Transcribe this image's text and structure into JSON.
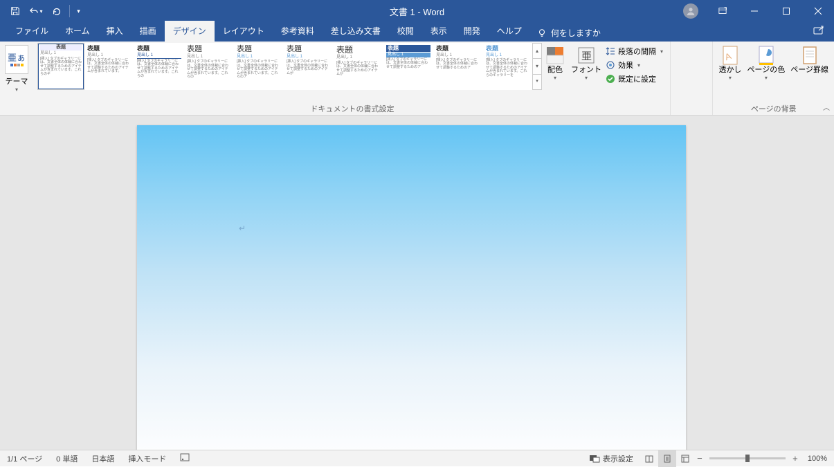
{
  "title": "文書 1  -  Word",
  "tabs": [
    "ファイル",
    "ホーム",
    "挿入",
    "描画",
    "デザイン",
    "レイアウト",
    "参考資料",
    "差し込み文書",
    "校閲",
    "表示",
    "開発",
    "ヘルプ"
  ],
  "active_tab_index": 4,
  "tellme": "何をしますか",
  "ribbon": {
    "themes_label": "テーマ",
    "formatting_group_label": "ドキュメントの書式設定",
    "gallery_more_tip": "▾",
    "styles": [
      {
        "title": "表題",
        "sub": "見出し 1",
        "body": "[挿入] タブのギャラリーには、文書全体の体裁に合わせて調整するためのアイテムが含まれています。これらのギ"
      },
      {
        "title": "表題",
        "sub": "見出し 1",
        "body": "[挿入] タブのギャラリーには、文書全体の体裁に合わせて調整するためのアイテムが含まれています。"
      },
      {
        "title": "表題",
        "sub": "見出し 1",
        "body": "[挿入] タブのギャラリーには、文書全体の体裁に合わせて調整するためのアイテムが含まれています。これらの"
      },
      {
        "title": "表題",
        "sub": "見出し 1",
        "body": "[挿入] タブのギャラリーには、文書全体の体裁に合わせて調整するためのアイテムが含まれています。これらの"
      },
      {
        "title": "表題",
        "sub": "見出し 1",
        "body": "[挿入] タブのギャラリーには、文書全体の体裁に合わせて調整するためのアイテムが含まれています。これらのア"
      },
      {
        "title": "表題",
        "sub": "見出し 1",
        "body": "[挿入] タブのギャラリーには、文書全体の体裁に合わせて調整するためのアイテムが"
      },
      {
        "title": "表題",
        "sub": "見出し 1",
        "body": "[挿入] タブのギャラリーには、文書全体の体裁に合わせて調整するためのアイテムが"
      },
      {
        "title": "表題",
        "sub": "見出し 1",
        "body": "[挿入] タブのギャラリーには、文書全体の体裁に合わせて調整するためのア"
      },
      {
        "title": "表題",
        "sub": "見出し 1",
        "body": "[挿入] タブのギャラリーには、文書全体の体裁に合わせて調整するためのア"
      },
      {
        "title": "表題",
        "sub": "見出し 1",
        "body": "[挿入] タブのギャラリーには、文書全体の体裁に合わせて調整するためのアイテムが含まれています。これらのギャラリーを"
      }
    ],
    "colors": "配色",
    "fonts": "フォント",
    "para_spacing": "段落の間隔",
    "effects": "効果",
    "set_default": "既定に設定",
    "watermark": "透かし",
    "page_color": "ページの色",
    "page_borders": "ページ罫線",
    "background_group_label": "ページの背景"
  },
  "status": {
    "page": "1/1 ページ",
    "word_count": "0 単語",
    "language": "日本語",
    "insert_mode": "挿入モード",
    "display_settings": "表示設定",
    "zoom_pct": "100%"
  }
}
